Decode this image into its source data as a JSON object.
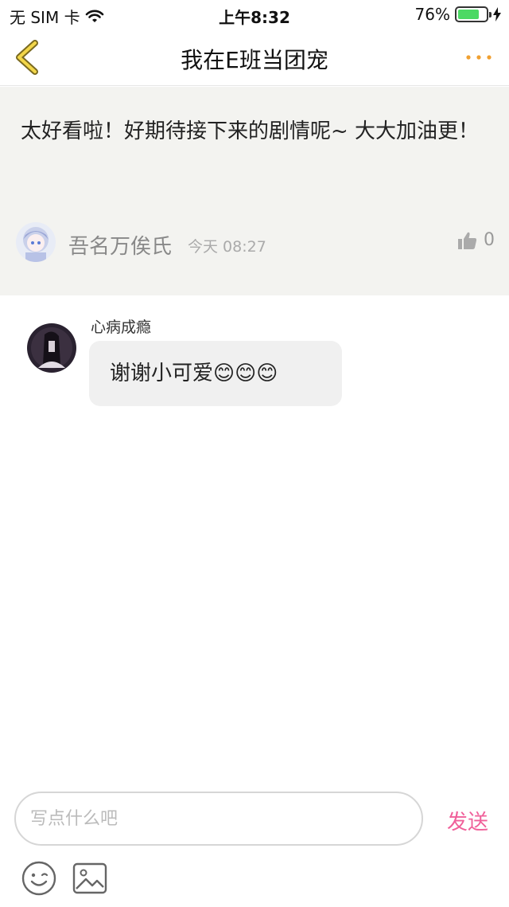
{
  "status_bar": {
    "carrier": "无 SIM 卡",
    "time": "上午8:32",
    "battery": "76%",
    "battery_level": 0.76
  },
  "nav": {
    "title": "我在E班当团宠",
    "accent": "#f0a030"
  },
  "post": {
    "text": "太好看啦！好期待接下来的剧情呢~ 大大加油更！",
    "author": "吾名万俟氏",
    "time": "今天 08:27",
    "like_count": "0"
  },
  "reply": {
    "author": "心病成瘾",
    "text": "谢谢小可爱😊😊😊"
  },
  "composer": {
    "placeholder": "写点什么吧",
    "send_label": "发送",
    "send_color": "#f0609a"
  },
  "icons": [
    "back-icon",
    "more-icon",
    "wifi-icon",
    "charging-icon",
    "thumbs-up-icon",
    "emoji-icon",
    "image-icon"
  ]
}
